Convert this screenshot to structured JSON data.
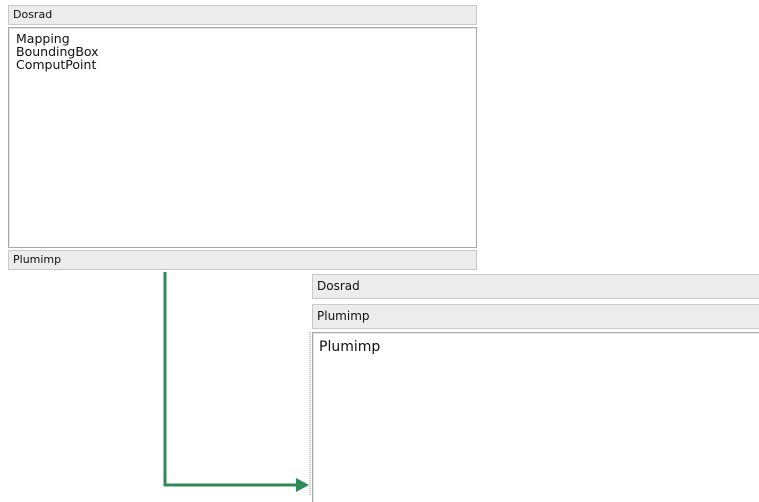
{
  "panel_top": {
    "header": "Dosrad",
    "items": [
      "Mapping",
      "BoundingBox",
      "ComputPoint"
    ],
    "footer": "Plumimp"
  },
  "panel_bottom": {
    "header": "Dosrad",
    "selected_header": "Plumimp",
    "items": [
      "Plumimp"
    ]
  },
  "connector": {
    "icon": "arrow-right-icon",
    "color": "#2e8b57"
  }
}
